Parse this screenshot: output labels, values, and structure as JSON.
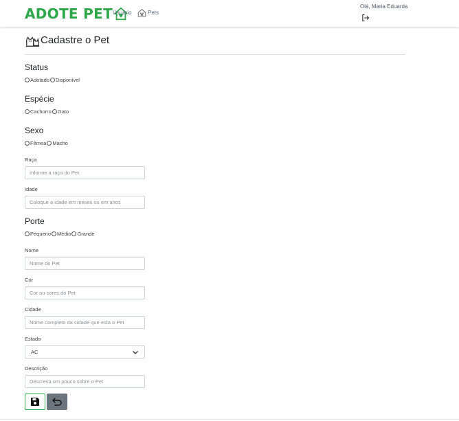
{
  "header": {
    "logo_text": "ADOTE PET",
    "nav_usuario": "Usuário",
    "nav_pets": "Pets",
    "greeting": "Olá, Maria Eduarda"
  },
  "page": {
    "title": "Cadastre o Pet"
  },
  "form": {
    "status": {
      "label": "Status",
      "options": [
        "Adotado",
        "Disponível"
      ]
    },
    "especie": {
      "label": "Espécie",
      "options": [
        "Cachorro",
        "Gato"
      ]
    },
    "sexo": {
      "label": "Sexo",
      "options": [
        "Fêmea",
        "Macho"
      ]
    },
    "raca": {
      "label": "Raça",
      "placeholder": "Informe a raça do Pet",
      "value": ""
    },
    "idade": {
      "label": "Idade",
      "placeholder": "Coloque a idade em meses ou em anos",
      "value": ""
    },
    "porte": {
      "label": "Porte",
      "options": [
        "Pequeno",
        "Médio",
        "Grande"
      ]
    },
    "nome": {
      "label": "Nome",
      "placeholder": "Nome do Pet",
      "value": ""
    },
    "cor": {
      "label": "Cor",
      "placeholder": "Cor ou cores do Pet",
      "value": ""
    },
    "cidade": {
      "label": "Cidade",
      "placeholder": "Nome completo da cidade que esta o Pet",
      "value": ""
    },
    "estado": {
      "label": "Estado",
      "selected": "AC"
    },
    "descricao": {
      "label": "Descrição",
      "placeholder": "Descreva um pouco sobre o Pet",
      "value": ""
    }
  },
  "colors": {
    "brand_green": "#2ea84a",
    "back_button": "#6c757d"
  },
  "icons": {
    "logo_house": "house-heart-icon",
    "pets_nav": "pet-house-icon",
    "logout": "logout-icon",
    "title": "dog-cat-icon",
    "save": "floppy-disk-icon",
    "back": "undo-arrow-icon"
  }
}
